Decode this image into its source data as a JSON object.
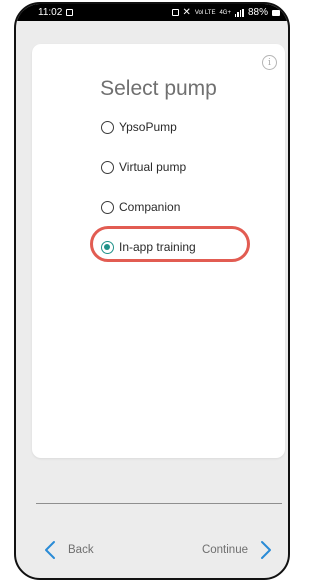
{
  "status_bar": {
    "time": "11:02",
    "icons": [
      "image-icon",
      "lock-icon",
      "mute-icon",
      "hd-icon",
      "4g-icon",
      "signal-icon",
      "battery-icon"
    ],
    "battery_percent": "88%",
    "mini_labels": [
      "Vol LTE",
      "4G+"
    ]
  },
  "card": {
    "title": "Select pump",
    "info_icon": "info-icon"
  },
  "options": [
    {
      "label": "YpsoPump",
      "selected": false
    },
    {
      "label": "Virtual pump",
      "selected": false
    },
    {
      "label": "Companion",
      "selected": false
    },
    {
      "label": "In-app training",
      "selected": true
    }
  ],
  "footer": {
    "back_label": "Back",
    "continue_label": "Continue"
  },
  "colors": {
    "accent": "#21928a",
    "highlight": "#e25c52",
    "nav_chevron": "#2a8bd6"
  }
}
